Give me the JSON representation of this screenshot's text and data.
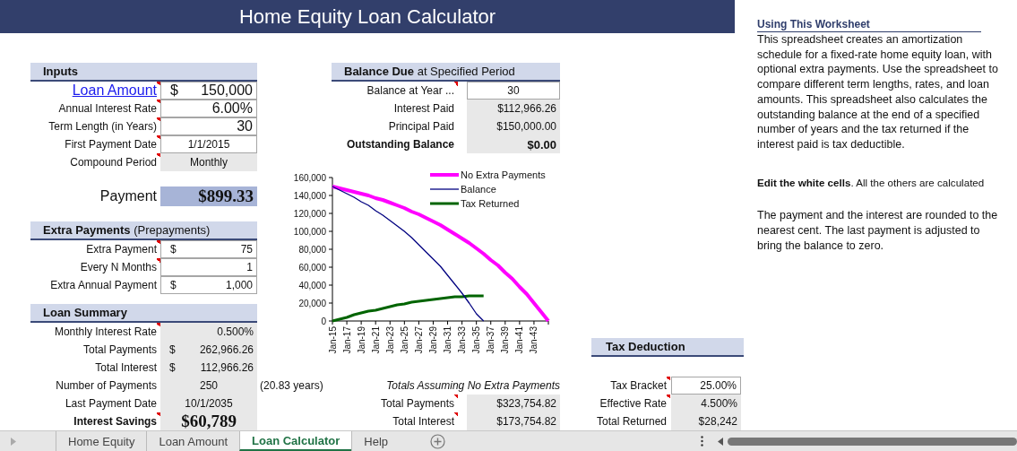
{
  "title": "Home Equity Loan Calculator",
  "inputs": {
    "heading": "Inputs",
    "bold": true,
    "rows": [
      {
        "label": "Loan Amount",
        "link": true,
        "comment": true,
        "kind": "entry-large",
        "currency": "$",
        "value": "150,000"
      },
      {
        "label": "Annual Interest Rate",
        "comment": true,
        "kind": "entry-large",
        "value": "6.00%"
      },
      {
        "label": "Term Length (in Years)",
        "comment": true,
        "kind": "entry-large",
        "value": "30"
      },
      {
        "label": "First Payment Date",
        "comment": true,
        "kind": "entry-centered",
        "value": "1/1/2015"
      },
      {
        "label": "Compound Period",
        "comment": true,
        "kind": "calculated-centered",
        "value": "Monthly"
      }
    ]
  },
  "payment": {
    "label": "Payment",
    "kind": "result",
    "value": "$899.33"
  },
  "extra_payments": {
    "heading": "**Extra Payments** (Prepayments)",
    "bold": false,
    "rows": [
      {
        "label": "Extra Payment",
        "comment": true,
        "kind": "entry",
        "currency": "$",
        "value": "75"
      },
      {
        "label": "Every N Months",
        "comment": true,
        "kind": "entry",
        "value": "1"
      },
      {
        "label": "Extra Annual Payment",
        "comment": false,
        "kind": "entry",
        "currency": "$",
        "value": "1,000"
      }
    ]
  },
  "loan_summary": {
    "heading": "Loan Summary",
    "bold": true,
    "rows": [
      {
        "label": "Monthly Interest Rate",
        "comment": true,
        "kind": "calculated",
        "value": "0.500%"
      },
      {
        "label": "Total Payments",
        "comment": false,
        "kind": "calculated",
        "currency": "$",
        "value": "262,966.26"
      },
      {
        "label": "Total Interest",
        "comment": false,
        "kind": "calculated",
        "currency": "$",
        "value": "112,966.26"
      },
      {
        "label": "Number of Payments",
        "comment": false,
        "kind": "calculated-centered",
        "value": "250",
        "note": "(20.83 years)"
      },
      {
        "label": "Last Payment Date",
        "comment": false,
        "kind": "calculated-centered",
        "value": "10/1/2035"
      },
      {
        "label": "Interest Savings",
        "bold": true,
        "comment": true,
        "kind": "calculated-large",
        "value": "$60,789"
      }
    ]
  },
  "balance_due": {
    "heading": "**Balance Due** at Specified Period",
    "bold": false,
    "rows": [
      {
        "label": "Balance at Year ...",
        "comment": true,
        "kind": "entry-centered",
        "value": "30"
      },
      {
        "label": "Interest Paid",
        "comment": false,
        "kind": "calculated",
        "value": "$112,966.26"
      },
      {
        "label": "Principal Paid",
        "comment": false,
        "kind": "calculated",
        "value": "$150,000.00"
      },
      {
        "label": "Outstanding Balance",
        "bold": true,
        "comment": false,
        "kind": "calculated-bold",
        "value": "$0.00"
      }
    ]
  },
  "chart_data": {
    "type": "line",
    "categories": [
      "Jan-15",
      null,
      "Jan-17",
      null,
      "Jan-19",
      null,
      "Jan-21",
      null,
      "Jan-23",
      null,
      "Jan-25",
      null,
      "Jan-27",
      null,
      "Jan-29",
      null,
      "Jan-31",
      null,
      "Jan-33",
      null,
      "Jan-35",
      null,
      "Jan-37",
      null,
      "Jan-39",
      null,
      "Jan-41",
      null,
      "Jan-43",
      null,
      null
    ],
    "series": [
      {
        "name": "No Extra Payments",
        "color": "#ff00ff",
        "values": [
          150000,
          148000,
          146000,
          144000,
          142000,
          140000,
          137000,
          135000,
          132000,
          129000,
          126000,
          122000,
          119000,
          115000,
          111000,
          107000,
          102000,
          97000,
          92000,
          87000,
          81000,
          75000,
          68000,
          62000,
          54000,
          47000,
          38000,
          30000,
          20000,
          10000,
          0
        ]
      },
      {
        "name": "Balance",
        "color": "#000080",
        "values": [
          150000,
          146000,
          142000,
          138000,
          133000,
          129000,
          123000,
          118000,
          112000,
          106000,
          100000,
          93000,
          85000,
          77000,
          69000,
          61000,
          51000,
          41000,
          31000,
          20000,
          8000,
          0,
          null,
          null,
          null,
          null,
          null,
          null,
          null,
          null,
          null
        ]
      },
      {
        "name": "Tax Returned",
        "color": "#006400",
        "values": [
          0,
          2000,
          4000,
          7000,
          9000,
          11000,
          12000,
          14000,
          16000,
          18000,
          19000,
          21000,
          22000,
          23000,
          24000,
          25000,
          26000,
          27000,
          27000,
          28000,
          28000,
          28000,
          null,
          null,
          null,
          null,
          null,
          null,
          null,
          null,
          null
        ]
      }
    ],
    "ylim": [
      0,
      160000
    ],
    "legend": "upper right",
    "yticks": [
      {
        "value": 0,
        "label": "0"
      },
      {
        "value": 20000,
        "label": "20,000"
      },
      {
        "value": 40000,
        "label": "40,000"
      },
      {
        "value": 60000,
        "label": "60,000"
      },
      {
        "value": 80000,
        "label": "80,000"
      },
      {
        "value": 100000,
        "label": "100,000"
      },
      {
        "value": 120000,
        "label": "120,000"
      },
      {
        "value": 140000,
        "label": "140,000"
      },
      {
        "value": 160000,
        "label": "160,000"
      }
    ]
  },
  "no_extra_totals": {
    "caption": "Totals Assuming No Extra Payments",
    "rows": [
      {
        "label": "Total Payments",
        "comment": true,
        "kind": "calculated",
        "value": "$323,754.82"
      },
      {
        "label": "Total Interest",
        "comment": true,
        "kind": "calculated",
        "value": "$173,754.82"
      }
    ]
  },
  "tax_deduction": {
    "heading": "Tax Deduction",
    "bold": true,
    "rows": [
      {
        "label": "Tax Bracket",
        "comment": true,
        "kind": "entry",
        "value": "25.00%"
      },
      {
        "label": "Effective Rate",
        "comment": true,
        "kind": "calculated",
        "value": "4.500%"
      },
      {
        "label": "Total Returned",
        "comment": false,
        "kind": "calculated",
        "value": "$28,242"
      }
    ]
  },
  "notes": {
    "heading": "Using This Worksheet",
    "paragraphs": [
      "This spreadsheet creates an amortization schedule for a fixed-rate home equity loan, with optional extra payments. Use the spreadsheet to compare different term lengths, rates, and loan amounts. This spreadsheet also calculates the outstanding balance at the end of a specified number of years and the tax returned if the interest paid is tax deductible.",
      "**Edit the white cells**. All the others are calculated",
      "The payment and the interest are rounded to the nearest cent. The last payment is adjusted to bring the balance to zero."
    ]
  },
  "sheet_tabs": [
    {
      "label": "Home Equity",
      "selected": false
    },
    {
      "label": "Loan Amount",
      "selected": false
    },
    {
      "label": "Loan Calculator",
      "selected": true
    },
    {
      "label": "Help",
      "selected": false
    }
  ]
}
